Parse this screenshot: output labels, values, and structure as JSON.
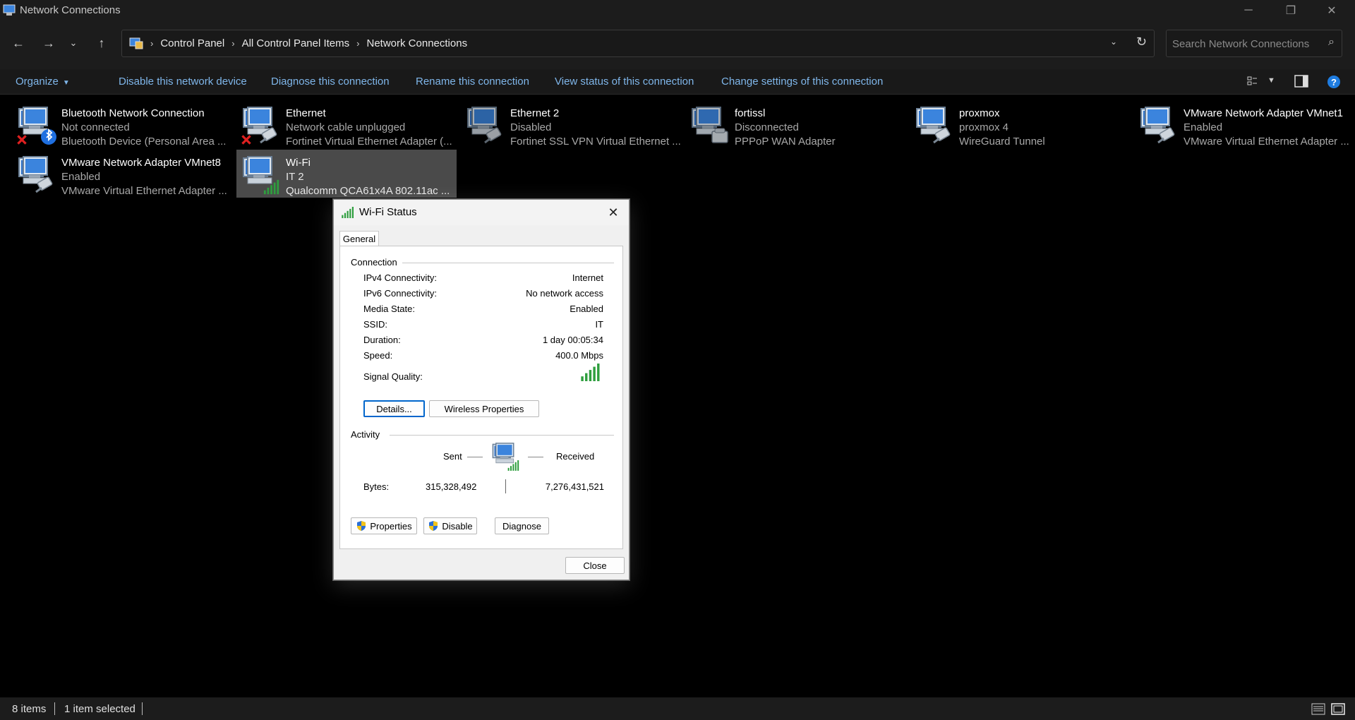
{
  "window": {
    "title": "Network Connections"
  },
  "address": {
    "crumbs": [
      "Control Panel",
      "All Control Panel Items",
      "Network Connections"
    ]
  },
  "search": {
    "placeholder": "Search Network Connections"
  },
  "commands": {
    "organize": "Organize",
    "disable": "Disable this network device",
    "diagnose": "Diagnose this connection",
    "rename": "Rename this connection",
    "view_status": "View status of this connection",
    "change_settings": "Change settings of this connection"
  },
  "connections": [
    {
      "name": "Bluetooth Network Connection",
      "status": "Not connected",
      "device": "Bluetooth Device (Personal Area ...",
      "icon": "bluetooth-adapter-icon"
    },
    {
      "name": "Ethernet",
      "status": "Network cable unplugged",
      "device": "Fortinet Virtual Ethernet Adapter (...",
      "icon": "ethernet-adapter-icon"
    },
    {
      "name": "Ethernet 2",
      "status": "Disabled",
      "device": "Fortinet SSL VPN Virtual Ethernet ...",
      "icon": "ethernet-adapter-icon"
    },
    {
      "name": "fortissl",
      "status": "Disconnected",
      "device": "PPPoP WAN Adapter",
      "icon": "dialup-adapter-icon"
    },
    {
      "name": "proxmox",
      "status": "proxmox 4",
      "device": "WireGuard Tunnel",
      "icon": "tunnel-adapter-icon"
    },
    {
      "name": "VMware Network Adapter VMnet1",
      "status": "Enabled",
      "device": "VMware Virtual Ethernet Adapter ...",
      "icon": "ethernet-adapter-icon"
    },
    {
      "name": "VMware Network Adapter VMnet8",
      "status": "Enabled",
      "device": "VMware Virtual Ethernet Adapter ...",
      "icon": "ethernet-adapter-icon"
    },
    {
      "name": "Wi-Fi",
      "status": "IT 2",
      "device": "Qualcomm QCA61x4A 802.11ac ...",
      "icon": "wifi-adapter-icon"
    }
  ],
  "statusbar": {
    "items": "8 items",
    "selected": "1 item selected"
  },
  "dialog": {
    "title": "Wi-Fi Status",
    "tab": "General",
    "connection_label": "Connection",
    "rows": [
      {
        "k": "IPv4 Connectivity:",
        "v": "Internet"
      },
      {
        "k": "IPv6 Connectivity:",
        "v": "No network access"
      },
      {
        "k": "Media State:",
        "v": "Enabled"
      },
      {
        "k": "SSID:",
        "v": "IT"
      },
      {
        "k": "Duration:",
        "v": "1 day 00:05:34"
      },
      {
        "k": "Speed:",
        "v": "400.0 Mbps"
      }
    ],
    "signal_label": "Signal Quality:",
    "signal_bars": 5,
    "details_button": "Details...",
    "wireless_button": "Wireless Properties",
    "activity_label": "Activity",
    "sent_label": "Sent",
    "received_label": "Received",
    "bytes_label": "Bytes:",
    "bytes_sent": "315,328,492",
    "bytes_received": "7,276,431,521",
    "properties_button": "Properties",
    "disable_button": "Disable",
    "diagnose_button": "Diagnose",
    "close_button": "Close"
  },
  "colors": {
    "link": "#7fb6ea",
    "selected": "#4a4a4a",
    "signal": "#2e9e3e"
  }
}
